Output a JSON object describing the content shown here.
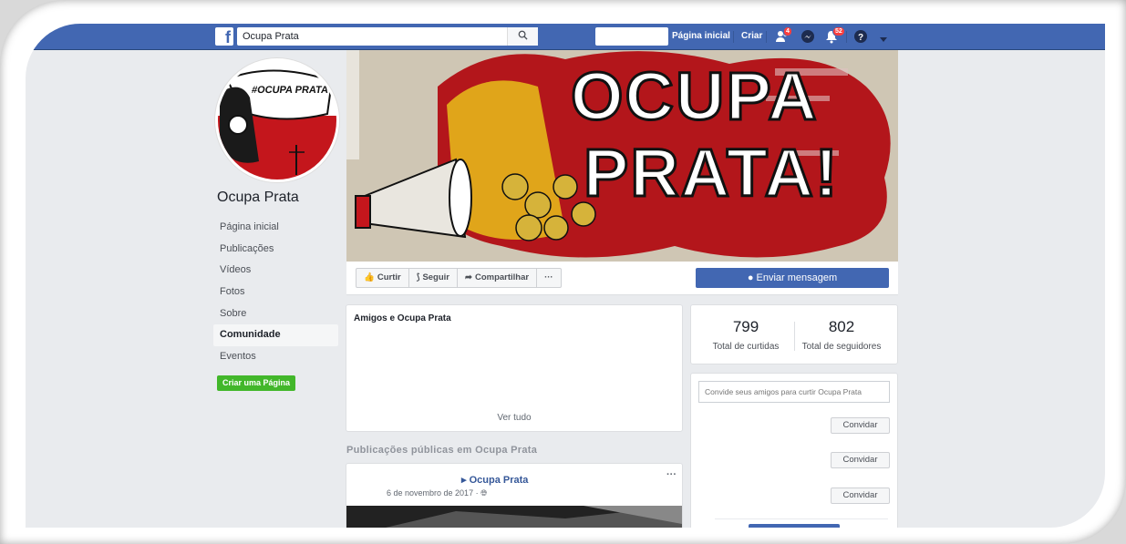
{
  "topbar": {
    "search_value": "Ocupa Prata",
    "home_label": "Página inicial",
    "create_label": "Criar",
    "friend_requests_badge": "4",
    "notifications_badge": "52"
  },
  "sidebar": {
    "page_name": "Ocupa Prata",
    "profile_pic_text": "#OCUPA PRATA !",
    "items": [
      {
        "label": "Página inicial"
      },
      {
        "label": "Publicações"
      },
      {
        "label": "Vídeos"
      },
      {
        "label": "Fotos"
      },
      {
        "label": "Sobre"
      },
      {
        "label": "Comunidade"
      },
      {
        "label": "Eventos"
      }
    ],
    "active_item": "Comunidade",
    "create_page_label": "Criar uma Página"
  },
  "cover": {
    "line1": "OCUPA",
    "line2": "PRATA!"
  },
  "actions": {
    "like_label": "Curtir",
    "follow_label": "Seguir",
    "share_label": "Compartilhar",
    "more_label": "···",
    "message_label": "Enviar mensagem"
  },
  "friends_card": {
    "title": "Amigos e Ocupa Prata",
    "see_all": "Ver tudo"
  },
  "public_posts": {
    "section_label": "Publicações públicas em Ocupa Prata",
    "author": "Ocupa Prata",
    "date": "6 de novembro de 2017 · ",
    "menu": "···"
  },
  "stats": {
    "likes_count": "799",
    "likes_label": "Total de curtidas",
    "followers_count": "802",
    "followers_label": "Total de seguidores"
  },
  "invite": {
    "placeholder": "Convide seus amigos para curtir Ocupa Prata",
    "button_label": "Convidar"
  },
  "colors": {
    "brand_blue": "#4267b2",
    "green": "#42b72a",
    "badge_red": "#fa3e3e"
  }
}
